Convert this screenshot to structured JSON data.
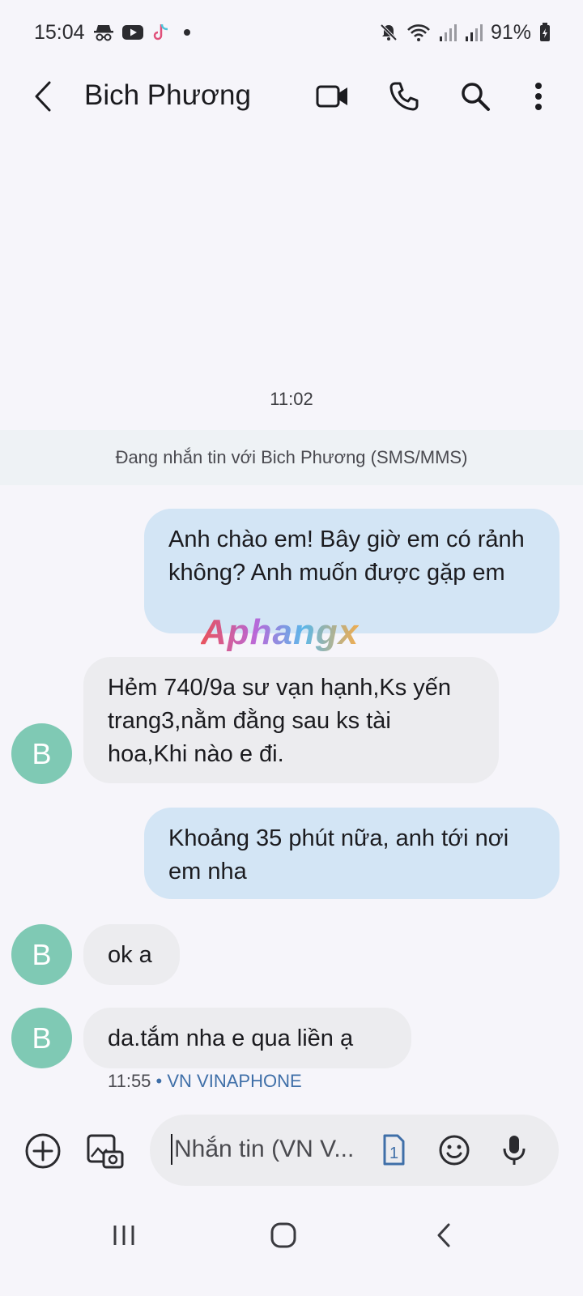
{
  "status_bar": {
    "time": "15:04",
    "battery": "91%",
    "icons_left": [
      "incognito-icon",
      "youtube-icon",
      "tiktok-icon",
      "notification-dot"
    ],
    "icons_right": [
      "mute-icon",
      "wifi-icon",
      "signal-icon",
      "signal-icon",
      "battery-icon"
    ]
  },
  "header": {
    "title": "Bich Phương",
    "actions": [
      "video-call-icon",
      "phone-icon",
      "search-icon",
      "more-icon"
    ]
  },
  "conversation": {
    "timestamp": "11:02",
    "banner": "Đang nhắn tin với Bich Phương (SMS/MMS)",
    "watermark": "Aphangx",
    "messages": [
      {
        "direction": "out",
        "text": "Anh chào em! Bây giờ em có rảnh không? Anh muốn được gặp em"
      },
      {
        "direction": "in",
        "avatar": "B",
        "text": "Hẻm 740/9a sư vạn hạnh,Ks yến trang3,nằm đằng sau ks tài hoa,Khi nào e đi."
      },
      {
        "direction": "out",
        "text": "Khoảng 35 phút nữa, anh tới nơi em nha"
      },
      {
        "direction": "in",
        "avatar": "B",
        "text": "ok a"
      },
      {
        "direction": "in",
        "avatar": "B",
        "text": "da.tắm nha e qua liền ạ"
      }
    ],
    "last_meta_time": "11:55",
    "last_meta_sep": "•",
    "last_meta_carrier": "VN VINAPHONE"
  },
  "composer": {
    "placeholder": "Nhắn tin (VN V...",
    "sim_number": "1"
  },
  "colors": {
    "outgoing_bubble": "#d3e5f5",
    "incoming_bubble": "#ececef",
    "avatar": "#7fc9b4",
    "accent": "#3f6fa8"
  }
}
